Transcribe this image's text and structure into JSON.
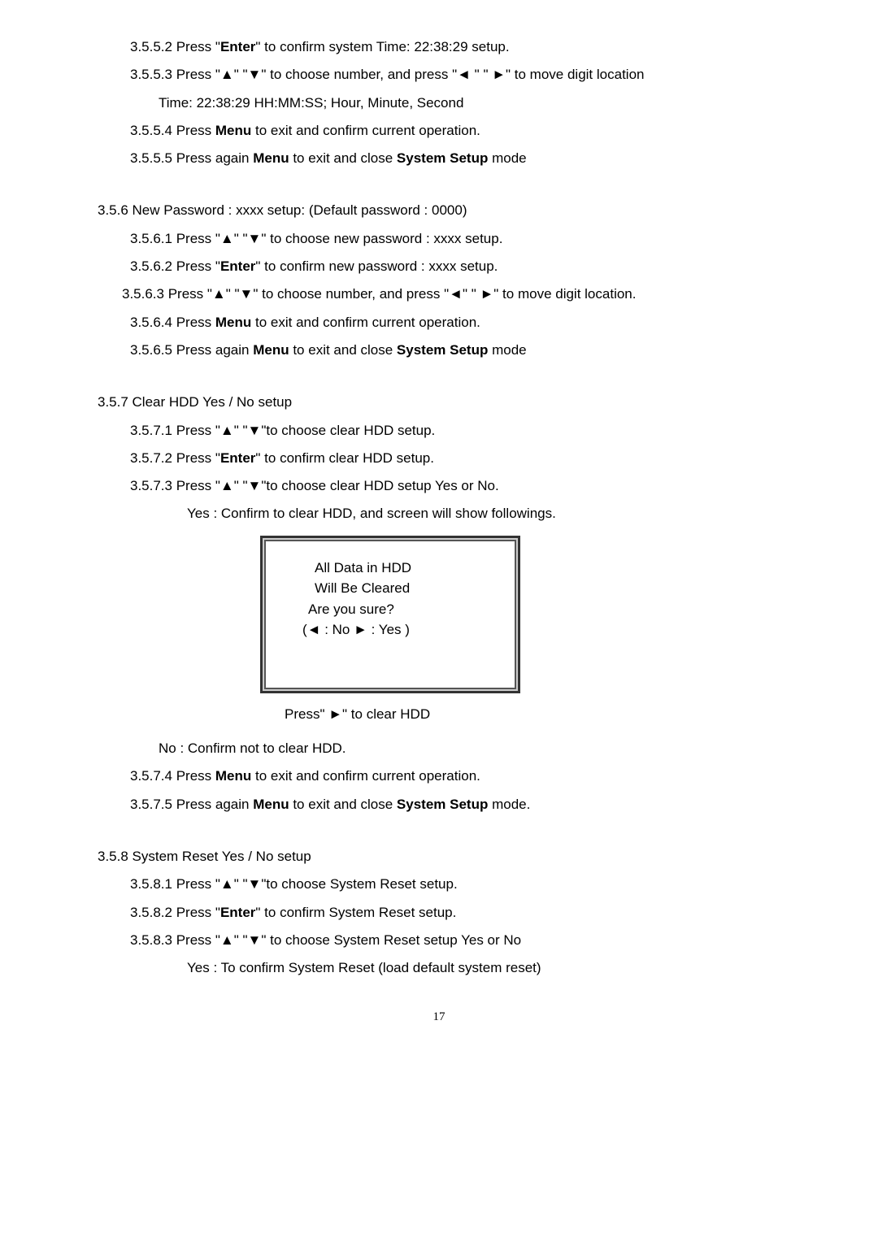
{
  "s3552": {
    "pre": "3.5.5.2 Press \"",
    "enter": "Enter",
    "post": "\" to confirm system Time: 22:38:29 setup."
  },
  "s3553": {
    "text": "3.5.5.3 Press \"▲\" \"▼\" to choose number, and press \"◄ \" \" ►\" to move digit location",
    "time": "Time: 22:38:29   HH:MM:SS; Hour, Minute, Second"
  },
  "s3554": {
    "pre": "3.5.5.4 Press ",
    "menu": "Menu",
    "post": " to exit and confirm current operation."
  },
  "s3555": {
    "pre": "3.5.5.5 Press again ",
    "menu": "Menu",
    "mid": " to exit and close ",
    "ss": "System Setup",
    "post": " mode"
  },
  "s356": "3.5.6 New Password : xxxx   setup:   (Default password : 0000)",
  "s3561": "3.5.6.1 Press   \"▲\" \"▼\" to choose new password : xxxx setup.",
  "s3562": {
    "pre": "3.5.6.2 Press \"",
    "enter": "Enter",
    "post": "\" to confirm new password : xxxx setup."
  },
  "s3563": "3.5.6.3 Press \"▲\" \"▼\" to choose number, and press \"◄\" \" ►\" to move digit location.",
  "s3564": {
    "pre": "3.5.6.4 Press ",
    "menu": "Menu",
    "post": " to exit and confirm current operation."
  },
  "s3565": {
    "pre": "3.5.6.5 Press again ",
    "menu": "Menu",
    "mid": " to exit and close ",
    "ss": "System Setup",
    "post": " mode"
  },
  "s357": "3.5.7 Clear HDD Yes / No setup",
  "s3571": "3.5.7.1 Press \"▲\" \"▼\"to choose clear HDD setup.",
  "s3572": {
    "pre": "3.5.7.2 Press \"",
    "enter": "Enter",
    "post": "\" to confirm clear HDD setup."
  },
  "s3573": "3.5.7.3 Press \"▲\" \"▼\"to choose clear HDD setup Yes or No.",
  "s3573yes": "Yes : Confirm to clear HDD, and screen will show followings.",
  "dialog": {
    "l1": "All Data in HDD",
    "l2": "Will Be Cleared",
    "l3": "Are you sure?",
    "l4": "(◄ : No ► : Yes )"
  },
  "pressclear": "Press\" ►\" to clear HDD",
  "noconfirm": "No : Confirm not to clear HDD.",
  "s3574": {
    "pre": "3.5.7.4 Press ",
    "menu": "Menu",
    "post": " to exit and confirm current operation."
  },
  "s3575": {
    "pre": "3.5.7.5 Press again ",
    "menu": "Menu",
    "mid": " to exit and close ",
    "ss": "System Setup",
    "post": " mode."
  },
  "s358": "3.5.8 System Reset Yes / No setup",
  "s3581": "3.5.8.1 Press \"▲\" \"▼\"to choose System Reset setup.",
  "s3582": {
    "pre": "3.5.8.2 Press \"",
    "enter": "Enter",
    "post": "\" to confirm System Reset setup."
  },
  "s3583": "3.5.8.3 Press \"▲\" \"▼\" to choose System Reset setup Yes or No",
  "s3583yes": "Yes : To confirm System Reset (load default system reset)",
  "page": "17"
}
